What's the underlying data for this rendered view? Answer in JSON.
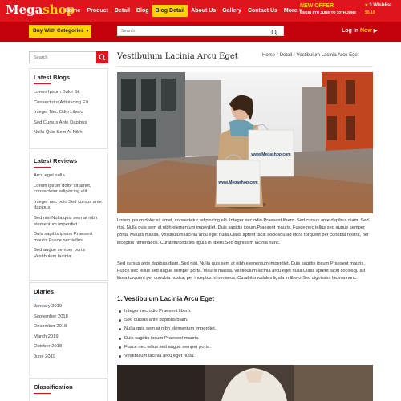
{
  "header": {
    "logo_main": "Mega",
    "logo_accent": "shop",
    "nav": [
      {
        "label": "Home"
      },
      {
        "label": "Product"
      },
      {
        "label": "Detail"
      },
      {
        "label": "Blog"
      },
      {
        "label": "Blog Detail",
        "active": true
      },
      {
        "label": "About Us"
      },
      {
        "label": "Gallery"
      },
      {
        "label": "Contact Us"
      },
      {
        "label": "More"
      }
    ],
    "offer_title": "NEW OFFER",
    "offer_sub": "BEGIN 5TH JUNE TO 10TH JUNE",
    "wishlist_label": "3 Wishlist",
    "wishlist_price": "$0.10"
  },
  "subbar": {
    "category_label": "Buy With Categories",
    "search_placeholder": "Search",
    "login_label": "Log In",
    "login_now": "Now"
  },
  "sidebar": {
    "search_placeholder": "Search",
    "latest_blogs_title": "Latest Blogs",
    "latest_blogs": [
      "Lorem Ipsum Dolor Sit",
      "Consectutur Adipiscing Elit",
      "Integer Nec Odio Libero",
      "Sed Cursus Ante Dapibus",
      "Nulla Quis Sem At Nibh"
    ],
    "latest_reviews_title": "Latest Reviews",
    "latest_reviews": [
      "Arcu eget nulla",
      "Lorem ipsum dolor sit amet, consectetur adipiscing elit",
      "Integer nec odio Sed cursus ante dapibus",
      "Sed nisi Nulla quis sem at nibh elementum imperdiet",
      "Duis sagittis ipsum Praesent mauris Fusce nec tellus",
      "Sed augue semper porta Vestibulum lacinia"
    ],
    "diaries_title": "Diaries",
    "diaries": [
      "January 2019",
      "September 2018",
      "December 2018",
      "March 2019",
      "October 2018",
      "June 2019"
    ],
    "classification_title": "Classification"
  },
  "main": {
    "title": "Vestibulum Lacinia Arcu Eget",
    "breadcrumb": [
      "Home",
      "Detail",
      "Vestibulum Lacinia Arcu Eget"
    ],
    "hero_bag_text": "www.Megashop.com",
    "para1": "Lorem ipsum dolor sit amet, consectetur adipiscing elit. Integer nec odio.Praesent libero. Sed cursus ante dapibus diam. Sed nisi. Nulla quis sem at nibh elementum imperdiet. Duis sagittis ipsum.Praesent mauris. Fusce nec tellus sed augue semper porta. Mauris massa. Vestibulum lacinia arcu eget nulla.Class aptent taciti sociosqu ad litora torquent per conubia nostra, per inceptos himenaeos. Curabitursodales ligula in libero.Sed dignissim lacinia nunc.",
    "para2": "Sed cursus ante dapibus diam. Sed nisi. Nulla quis sem at nibh elementum imperdiet. Duis sagittis ipsum.Praesent mauris. Fusce nec tellus sed augue semper porta. Mauris massa. Vestibulum lacinia arcu eget nulla.Class aptent taciti sociosqu ad litora torquent per conubia nostra, per inceptos himenaeos. Curabitursodales ligula in libero.Sed dignissim lacinia nunc.",
    "section_heading": "1. Vestibulum Lacinia Arcu Eget",
    "bullets": [
      "Integer nec odio Praesent libero.",
      "Sed cursus ante dapibus diam.",
      "Nulla quis sem at nibh elementum imperdiet.",
      "Duis sagittis ipsum Praesent mauris.",
      "Fusce nec tellus sed augue semper porta.",
      "Vestibulum lacinia arcu eget nulla."
    ]
  },
  "colors": {
    "brand_red": "#e0141c",
    "dark_red": "#c4000a",
    "accent_yellow": "#ffd200"
  }
}
